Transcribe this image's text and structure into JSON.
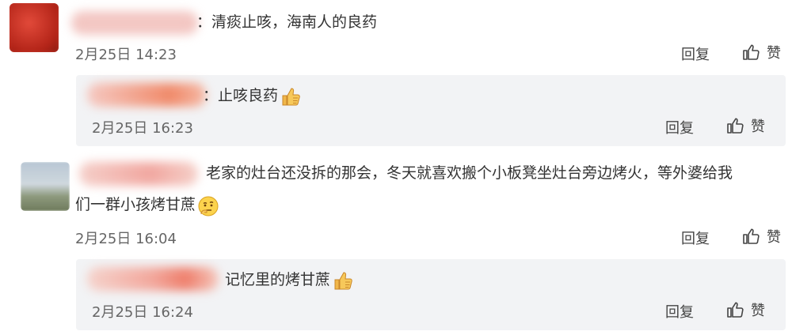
{
  "comments": [
    {
      "text_sep": "：",
      "text": "清痰止咳，海南人的良药",
      "time": "2月25日 14:23",
      "reply_label": "回复",
      "like_label": "赞",
      "reply": {
        "text_sep": "：",
        "text": "止咳良药",
        "time": "2月25日 16:23",
        "reply_label": "回复",
        "like_label": "赞",
        "emoji": "thumbs-up"
      }
    },
    {
      "text_line1": "老家的灶台还没拆的那会，冬天就喜欢搬个小板凳坐灶台旁边烤火，等外婆给我",
      "text_line2": "们一群小孩烤甘蔗",
      "time": "2月25日 16:04",
      "reply_label": "回复",
      "like_label": "赞",
      "emoji": "thinking-face",
      "reply": {
        "text_sep": "：",
        "text": "记忆里的烤甘蔗",
        "time": "2月25日 16:24",
        "reply_label": "回复",
        "like_label": "赞",
        "emoji": "thumbs-up"
      }
    }
  ],
  "colors": {
    "reply_bg": "#f2f3f5",
    "text": "#333333",
    "meta": "#666666"
  }
}
